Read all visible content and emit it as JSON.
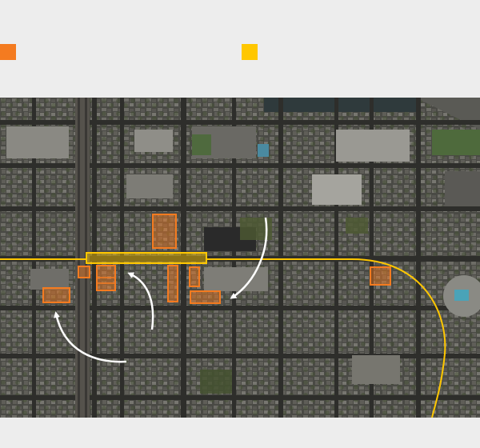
{
  "legend": {
    "items": [
      {
        "color": "#f47b20",
        "label": ""
      },
      {
        "color": "#ffc700",
        "label": ""
      }
    ]
  },
  "map": {
    "type": "aerial-satellite",
    "colors": {
      "highlight_parcel": "#f47b20",
      "highlight_corridor": "#ffc700",
      "route_line": "#ffc700",
      "arrow": "#ffffff"
    }
  }
}
